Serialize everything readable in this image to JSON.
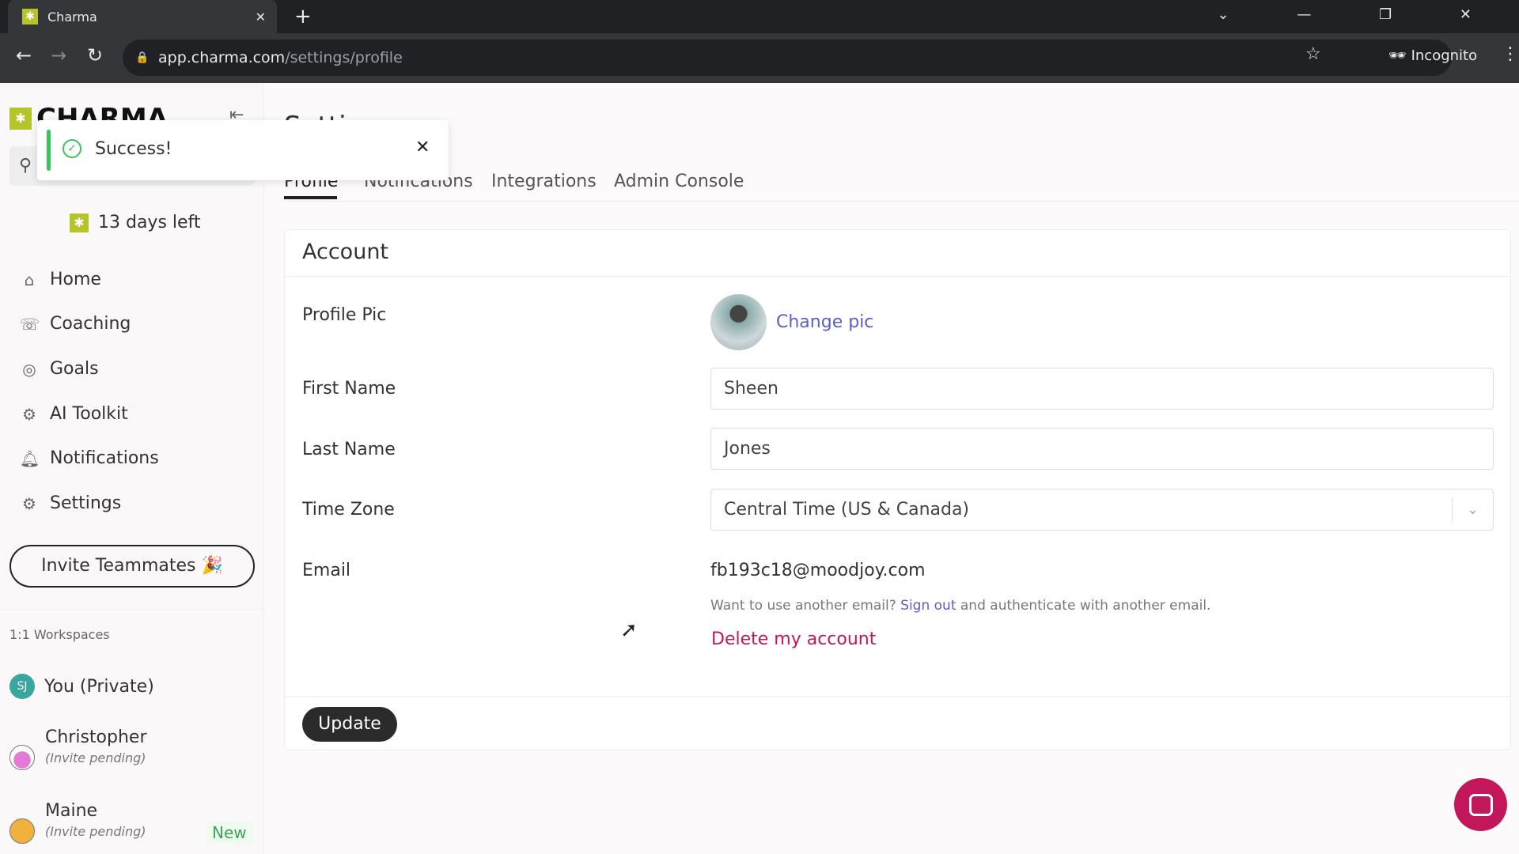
{
  "browser": {
    "tab_title": "Charma",
    "url_host": "app.charma.com",
    "url_path": "/settings/profile",
    "profile": "Incognito"
  },
  "toast": {
    "message": "Success!"
  },
  "sidebar": {
    "logo": "CHARMA",
    "trial": "13 days left",
    "nav": [
      {
        "label": "Home",
        "icon": "home-icon"
      },
      {
        "label": "Coaching",
        "icon": "coaching-icon"
      },
      {
        "label": "Goals",
        "icon": "target-icon"
      },
      {
        "label": "AI Toolkit",
        "icon": "robot-icon"
      },
      {
        "label": "Notifications",
        "icon": "bell-icon"
      },
      {
        "label": "Settings",
        "icon": "gear-icon"
      }
    ],
    "invite": "Invite Teammates 🎉",
    "workspaces_label": "1:1 Workspaces",
    "workspaces": [
      {
        "name": "You (Private)",
        "initials": "SJ",
        "color": "#3aa6a0"
      },
      {
        "name": "Christopher",
        "status": "(Invite pending)"
      },
      {
        "name": "Maine",
        "status": "(Invite pending)",
        "badge": "New"
      }
    ]
  },
  "main": {
    "title": "Settings",
    "tabs": [
      "Profile",
      "Notifications",
      "Integrations",
      "Admin Console"
    ],
    "card_title": "Account",
    "fields": {
      "profile_pic": "Profile Pic",
      "change_pic": "Change pic",
      "first_name_label": "First Name",
      "first_name": "Sheen",
      "last_name_label": "Last Name",
      "last_name": "Jones",
      "timezone_label": "Time Zone",
      "timezone": "Central Time (US & Canada)",
      "email_label": "Email",
      "email": "fb193c18@moodjoy.com",
      "help_pre": "Want to use another email?",
      "sign_out": "Sign out",
      "help_post": "and authenticate with another email.",
      "delete": "Delete my account"
    },
    "update": "Update"
  },
  "colors": {
    "accent": "#b5c42a",
    "link": "#5b5fc7",
    "danger": "#c2185b",
    "success": "#34c759",
    "chat": "#c2185b"
  }
}
